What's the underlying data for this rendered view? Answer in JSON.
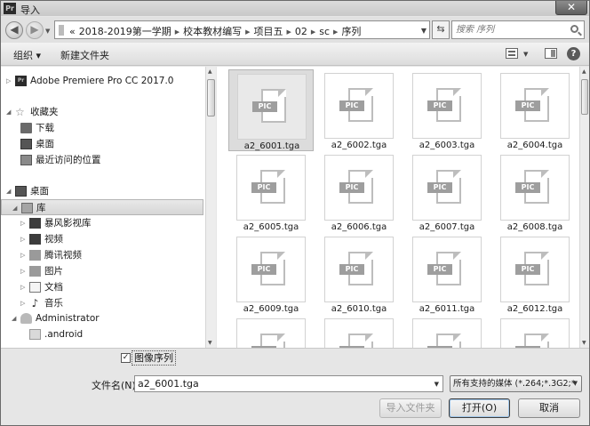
{
  "window": {
    "title": "导入",
    "app_icon": "Pr",
    "close_label": "✕"
  },
  "address": {
    "crumbs": [
      "«",
      "2018-2019第一学期",
      "校本教材编写",
      "项目五",
      "02",
      "sc",
      "序列"
    ],
    "search_placeholder": "搜索 序列"
  },
  "toolbar": {
    "organize_label": "组织 ▾",
    "new_folder_label": "新建文件夹",
    "help_label": "?"
  },
  "nav": {
    "items": [
      {
        "label": "Adobe Premiere Pro CC 2017.0",
        "icon": "premiere-icon",
        "level": 0,
        "twisty": "▷"
      },
      {
        "label": "收藏夹",
        "icon": "star-icon",
        "level": 0,
        "twisty": "◢"
      },
      {
        "label": "下载",
        "icon": "downloads-icon",
        "level": 1,
        "twisty": ""
      },
      {
        "label": "桌面",
        "icon": "desktop-icon",
        "level": 1,
        "twisty": ""
      },
      {
        "label": "最近访问的位置",
        "icon": "recent-places-icon",
        "level": 1,
        "twisty": ""
      },
      {
        "label": "桌面",
        "icon": "desktop-icon",
        "level": 0,
        "twisty": "◢"
      },
      {
        "label": "库",
        "icon": "library-icon",
        "level": 1,
        "twisty": "◢"
      },
      {
        "label": "暴风影视库",
        "icon": "video-library-icon",
        "level": 2,
        "twisty": "▷"
      },
      {
        "label": "视频",
        "icon": "video-icon",
        "level": 2,
        "twisty": "▷"
      },
      {
        "label": "腾讯视频",
        "icon": "tencent-video-icon",
        "level": 2,
        "twisty": "▷"
      },
      {
        "label": "图片",
        "icon": "pictures-icon",
        "level": 2,
        "twisty": "▷"
      },
      {
        "label": "文档",
        "icon": "documents-icon",
        "level": 2,
        "twisty": "▷"
      },
      {
        "label": "音乐",
        "icon": "music-icon",
        "level": 2,
        "twisty": "▷"
      },
      {
        "label": "Administrator",
        "icon": "user-icon",
        "level": 1,
        "twisty": "◢"
      },
      {
        "label": ".android",
        "icon": "folder-icon",
        "level": 2,
        "twisty": ""
      }
    ],
    "selected_index": 6
  },
  "files": {
    "thumb_label": "PIC",
    "items": [
      "a2_6001.tga",
      "a2_6002.tga",
      "a2_6003.tga",
      "a2_6004.tga",
      "a2_6005.tga",
      "a2_6006.tga",
      "a2_6007.tga",
      "a2_6008.tga",
      "a2_6009.tga",
      "a2_6010.tga",
      "a2_6011.tga",
      "a2_6012.tga",
      "",
      "",
      "",
      ""
    ],
    "selected_index": 0
  },
  "bottom": {
    "image_sequence_label": "图像序列",
    "image_sequence_checked": true,
    "filename_label": "文件名(N):",
    "filename_value": "a2_6001.tga",
    "filetype_value": "所有支持的媒体 (*.264;*.3G2;*",
    "import_folder_label": "导入文件夹",
    "open_label": "打开(O)",
    "cancel_label": "取消"
  }
}
